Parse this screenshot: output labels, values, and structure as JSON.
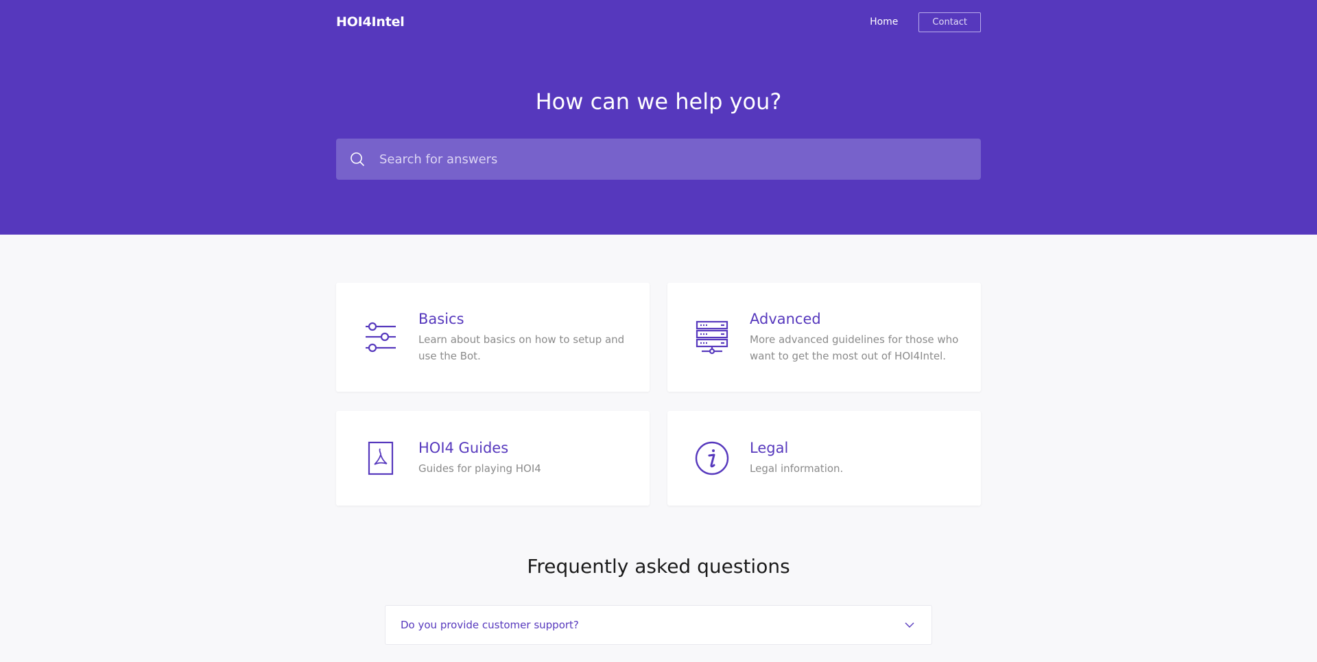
{
  "nav": {
    "brand": "HOI4Intel",
    "home_label": "Home",
    "contact_label": "Contact"
  },
  "hero": {
    "title": "How can we help you?",
    "search_placeholder": "Search for answers"
  },
  "cards": [
    {
      "title": "Basics",
      "description": "Learn about basics on how to setup and use the Bot.",
      "icon": "sliders-icon"
    },
    {
      "title": "Advanced",
      "description": "More advanced guidelines for those who want to get the most out of HOI4Intel.",
      "icon": "server-icon"
    },
    {
      "title": "HOI4 Guides",
      "description": "Guides for playing HOI4",
      "icon": "pdf-document-icon"
    },
    {
      "title": "Legal",
      "description": "Legal information.",
      "icon": "info-icon"
    }
  ],
  "faq": {
    "title": "Frequently asked questions",
    "items": [
      {
        "question": "Do you provide customer support?"
      }
    ]
  },
  "colors": {
    "accent": "#5638bd",
    "search_bg": "#7762cb",
    "page_bg": "#f8f8fa"
  }
}
